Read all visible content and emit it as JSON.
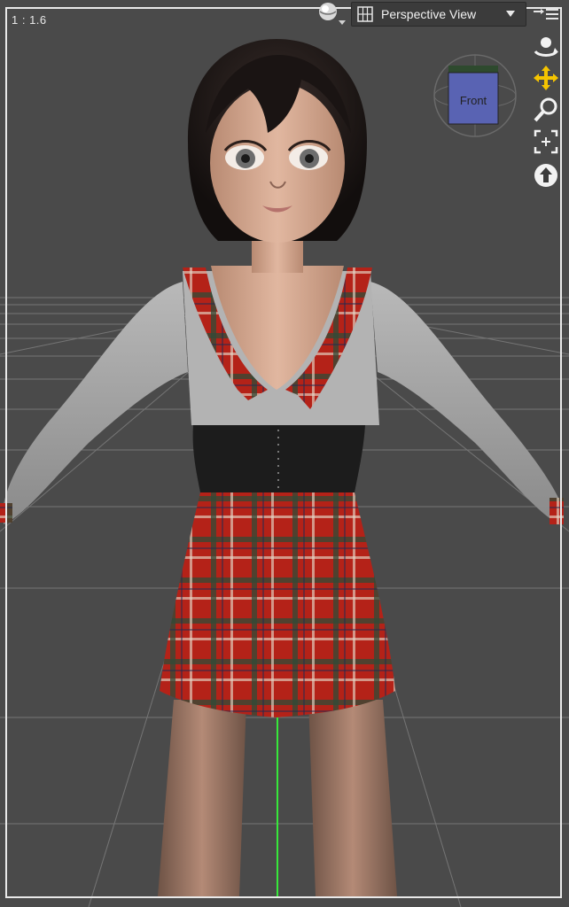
{
  "viewport": {
    "aspect_ratio": "1 : 1.6",
    "view_name": "Perspective View",
    "cube_face": "Front"
  },
  "toolbar": {
    "icons": [
      "camera-orbit-icon",
      "grid-view-icon",
      "chevron-down-icon",
      "menu-icon"
    ]
  },
  "tools": [
    {
      "name": "orbit-tool-icon"
    },
    {
      "name": "pan-tool-icon"
    },
    {
      "name": "zoom-tool-icon"
    },
    {
      "name": "frame-tool-icon"
    },
    {
      "name": "up-arrow-tool-icon"
    }
  ],
  "colors": {
    "background": "#4a4a4a",
    "grid": "#7a7a7a",
    "y_axis": "#37e83a",
    "cube": "#5963b3",
    "plaid_red": "#b42218",
    "sleeve_gray": "#a9a9a9"
  }
}
